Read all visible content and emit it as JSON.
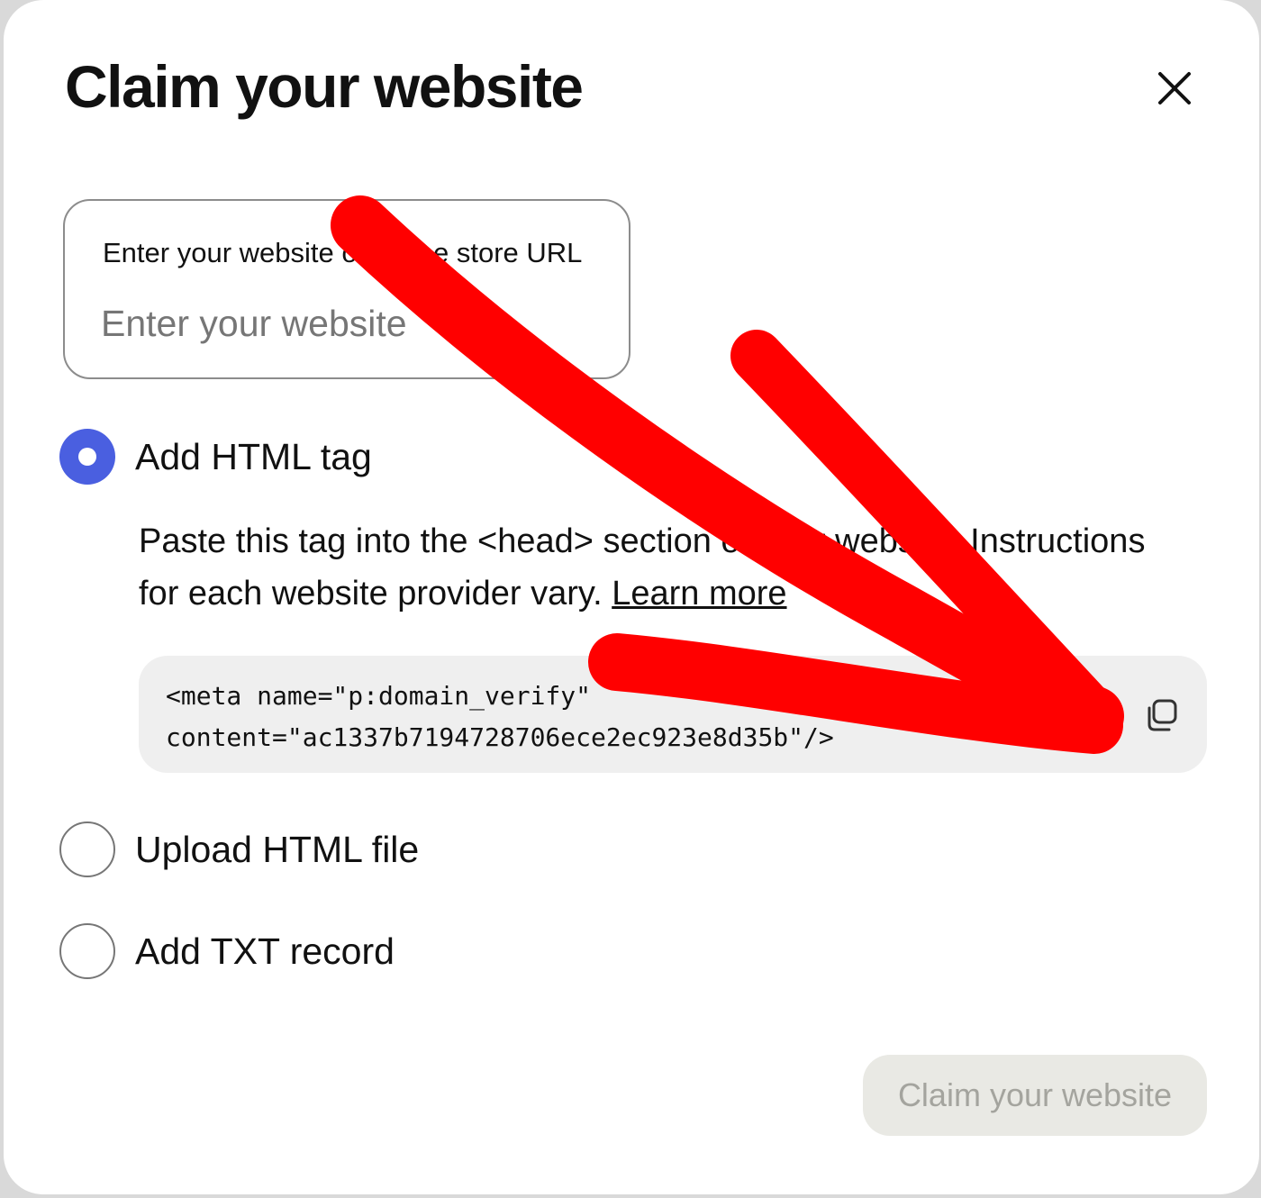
{
  "dialog": {
    "title": "Claim your website",
    "close_icon": "close-icon"
  },
  "url_field": {
    "label": "Enter your website or online store URL",
    "placeholder": "Enter your website",
    "value": ""
  },
  "options": [
    {
      "label": "Add HTML tag",
      "selected": true
    },
    {
      "label": "Upload HTML file",
      "selected": false
    },
    {
      "label": "Add TXT record",
      "selected": false
    }
  ],
  "html_tag_section": {
    "instructions": "Paste this tag into the <head> section of your website. Instructions for each website provider vary.",
    "learn_more": "Learn more",
    "code_line1": "<meta name=\"p:domain_verify\"",
    "code_line2": "content=\"ac1337b7194728706ece2ec923e8d35b\"/>",
    "copy_icon": "copy-icon"
  },
  "submit": {
    "label": "Claim your website",
    "enabled": false
  },
  "colors": {
    "radio_selected": "#4a5fe0",
    "annotation_arrow": "#ff0000",
    "submit_disabled_bg": "#e9e9e4",
    "submit_disabled_text": "#a4a49e"
  }
}
